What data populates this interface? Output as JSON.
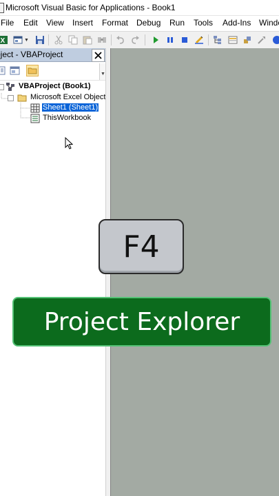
{
  "window": {
    "title": "Microsoft Visual Basic for Applications - Book1"
  },
  "menu": [
    "File",
    "Edit",
    "View",
    "Insert",
    "Format",
    "Debug",
    "Run",
    "Tools",
    "Add-Ins",
    "Window"
  ],
  "toolbar": {
    "icons": [
      "excel-icon",
      "insert-userform-icon",
      "save-icon",
      "cut-icon",
      "copy-icon",
      "paste-icon",
      "find-icon",
      "undo-icon",
      "redo-icon",
      "run-icon",
      "break-icon",
      "reset-icon",
      "design-mode-icon",
      "project-explorer-icon",
      "properties-icon",
      "object-browser-icon",
      "toolbox-icon",
      "help-icon"
    ]
  },
  "project_panel": {
    "title": "Project - VBAProject",
    "tree": {
      "root": "VBAProject (Book1)",
      "folder": "Microsoft Excel Objects",
      "items": [
        "Sheet1 (Sheet1)",
        "ThisWorkbook"
      ],
      "selected": "Sheet1 (Sheet1)"
    }
  },
  "overlay": {
    "key": "F4",
    "banner": "Project Explorer"
  },
  "colors": {
    "workspace": "#a3aaa3",
    "banner": "#0c6b1d",
    "banner_border": "#55c276",
    "selection": "#0a64d8",
    "panel_header": "#bfcde0"
  }
}
